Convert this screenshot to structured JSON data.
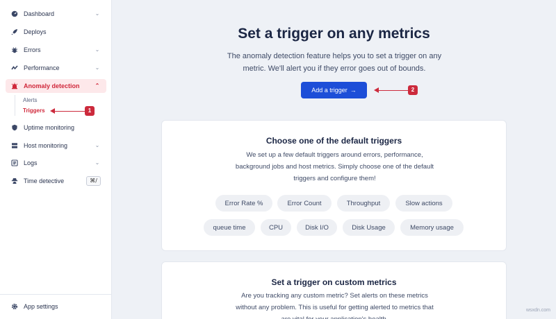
{
  "sidebar": {
    "items": [
      {
        "label": "Dashboard",
        "icon": "dashboard-gauge-icon"
      },
      {
        "label": "Deploys",
        "icon": "rocket-icon"
      },
      {
        "label": "Errors",
        "icon": "bug-icon"
      },
      {
        "label": "Performance",
        "icon": "performance-icon"
      },
      {
        "label": "Anomaly detection",
        "icon": "alarm-icon"
      },
      {
        "label": "Uptime monitoring",
        "icon": "shield-icon"
      },
      {
        "label": "Host monitoring",
        "icon": "server-icon"
      },
      {
        "label": "Logs",
        "icon": "logs-icon"
      },
      {
        "label": "Time detective",
        "icon": "detective-icon",
        "shortcut": "⌘/"
      }
    ],
    "sub_items": [
      {
        "label": "Alerts"
      },
      {
        "label": "Triggers"
      }
    ],
    "footer": {
      "label": "App settings",
      "icon": "gear-icon"
    }
  },
  "annotations": {
    "badge_1": "1",
    "badge_2": "2",
    "accent": "#cc2a3c"
  },
  "main": {
    "title": "Set a trigger on any metrics",
    "description": "The anomaly detection feature helps you to set a trigger on any metric. We'll alert you if they error goes out of bounds.",
    "add_button": "Add a trigger",
    "add_button_arrow": "→"
  },
  "default_card": {
    "title": "Choose one of the default triggers",
    "description": "We set up a few default triggers around errors, performance, background jobs and host metrics. Simply choose one of the default triggers and configure them!",
    "chips": [
      "Error Rate %",
      "Error Count",
      "Throughput",
      "Slow actions",
      "queue time",
      "CPU",
      "Disk I/O",
      "Disk Usage",
      "Memory usage"
    ]
  },
  "custom_card": {
    "title": "Set a trigger on custom metrics",
    "description": "Are you tracking any custom metric? Set alerts on these metrics without any problem. This is useful for getting alerted to metrics that are vital for your application's health."
  },
  "watermark": "wsxdn.com",
  "colors": {
    "primary": "#1d4ed8",
    "active_bg": "#fde8ea",
    "active_text": "#d0283b"
  }
}
